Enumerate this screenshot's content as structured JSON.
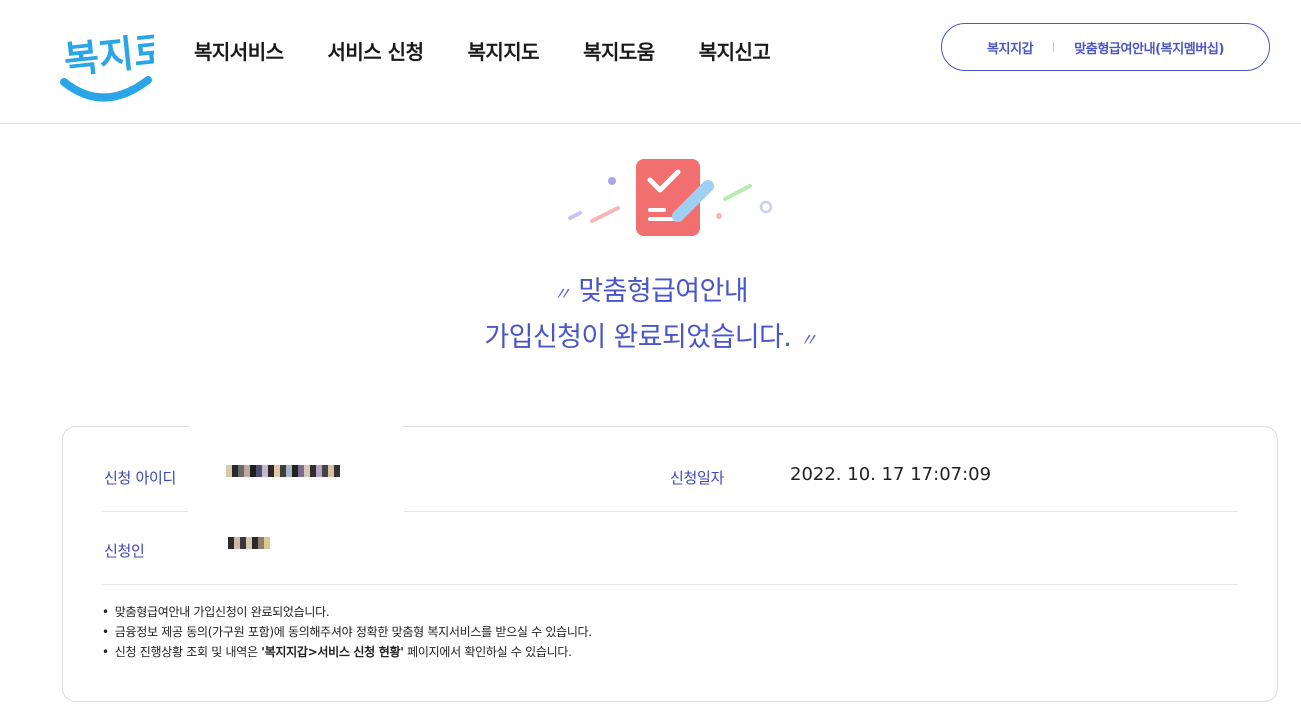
{
  "header": {
    "logo_text": "복지로",
    "nav": [
      "복지서비스",
      "서비스 신청",
      "복지지도",
      "복지도움",
      "복지신고"
    ],
    "util_links": [
      "복지지갑",
      "맞춤형급여안내(복지멤버십)"
    ]
  },
  "hero": {
    "open_quote": "〃",
    "line1": "맞춤형급여안내",
    "line2": "가입신청이 완료되었습니다.",
    "close_quote": "〃"
  },
  "info": {
    "id_label": "신청 아이디",
    "date_label": "신청일자",
    "date_value": "2022. 10. 17 17:07:09",
    "name_label": "신청인"
  },
  "notes": {
    "n1": "맞춤형급여안내 가입신청이 완료되었습니다.",
    "n2": "금융정보 제공 동의(가구원 포함)에 동의해주셔야 정확한 맞춤형 복지서비스를 받으실 수 있습니다.",
    "n3_pre": "신청 진행상황 조회 및 내역은 ",
    "n3_bold": "'복지지갑>서비스 신청 현황'",
    "n3_post": " 페이지에서 확인하실 수 있습니다."
  },
  "colors": {
    "brand_blue": "#4a55c9",
    "logo_blue": "#2aa5e8",
    "illustration_red": "#f26f6f"
  }
}
